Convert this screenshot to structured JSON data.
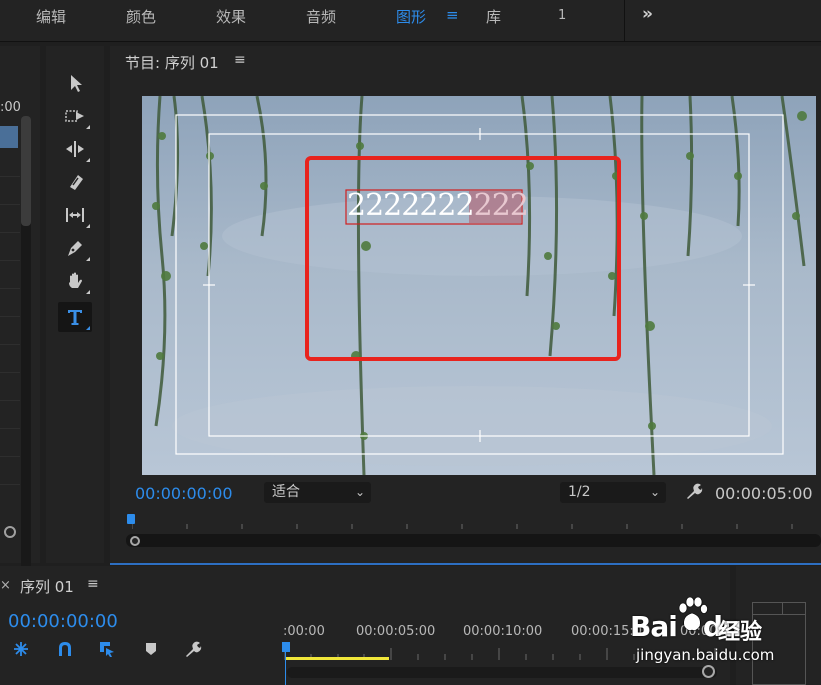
{
  "workspace_tabs": [
    {
      "label": "编辑",
      "active": false
    },
    {
      "label": "颜色",
      "active": false
    },
    {
      "label": "效果",
      "active": false
    },
    {
      "label": "音频",
      "active": false
    },
    {
      "label": "图形",
      "active": true
    },
    {
      "label": "库",
      "active": false
    },
    {
      "label": "1",
      "active": false
    }
  ],
  "workspace_menu_icon": "≡",
  "more_icon": "»",
  "left_panel": {
    "timecode_fragment": ":00"
  },
  "tools": [
    {
      "name": "selection-tool",
      "icon": "arrow"
    },
    {
      "name": "track-select-tool",
      "icon": "track-select"
    },
    {
      "name": "ripple-edit-tool",
      "icon": "ripple"
    },
    {
      "name": "razor-tool",
      "icon": "razor"
    },
    {
      "name": "slip-tool",
      "icon": "slip"
    },
    {
      "name": "pen-tool",
      "icon": "pen"
    },
    {
      "name": "hand-tool",
      "icon": "hand"
    },
    {
      "name": "type-tool",
      "icon": "T",
      "selected": true
    }
  ],
  "program_monitor": {
    "title": "节目: 序列 01",
    "menu_icon": "≡",
    "overlay_text_selected": "2222222",
    "overlay_text_highlighted": "222",
    "timecode": "00:00:00:00",
    "zoom_select": "适合",
    "resolution_select": "1/2",
    "duration": "00:00:05:00",
    "wrench_icon": "wrench-icon"
  },
  "timeline": {
    "close_icon": "×",
    "title": "序列 01",
    "menu_icon": "≡",
    "timecode": "00:00:00:00",
    "ruler_labels": [
      ":00:00",
      "00:00:05:00",
      "00:00:10:00",
      "00:00:15:00",
      "00:00"
    ]
  },
  "watermark": {
    "brand": "Bai",
    "brand2": "du",
    "product": "经验",
    "url": "jingyan.baidu.com"
  },
  "colors": {
    "accent": "#2d8ceb",
    "highlight_box": "#e8231d",
    "yellow_bar": "#f0e63a"
  }
}
